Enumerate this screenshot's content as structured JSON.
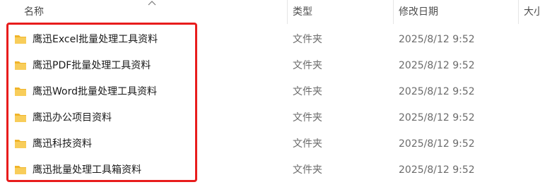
{
  "columns": {
    "name": "名称",
    "type": "类型",
    "date": "修改日期",
    "size": "大小"
  },
  "accent_color": "#e81c1c",
  "folder_color": "#f5c242",
  "files": [
    {
      "name": "鹰迅Excel批量处理工具资料",
      "type": "文件夹",
      "date": "2025/8/12 9:52",
      "icon": "folder-icon"
    },
    {
      "name": "鹰迅PDF批量处理工具资料",
      "type": "文件夹",
      "date": "2025/8/12 9:52",
      "icon": "folder-icon"
    },
    {
      "name": "鹰迅Word批量处理工具资料",
      "type": "文件夹",
      "date": "2025/8/12 9:52",
      "icon": "folder-icon"
    },
    {
      "name": "鹰迅办公项目资料",
      "type": "文件夹",
      "date": "2025/8/12 9:52",
      "icon": "folder-icon"
    },
    {
      "name": "鹰迅科技资料",
      "type": "文件夹",
      "date": "2025/8/12 9:52",
      "icon": "folder-icon"
    },
    {
      "name": "鹰迅批量处理工具箱资料",
      "type": "文件夹",
      "date": "2025/8/12 9:52",
      "icon": "folder-icon"
    }
  ]
}
